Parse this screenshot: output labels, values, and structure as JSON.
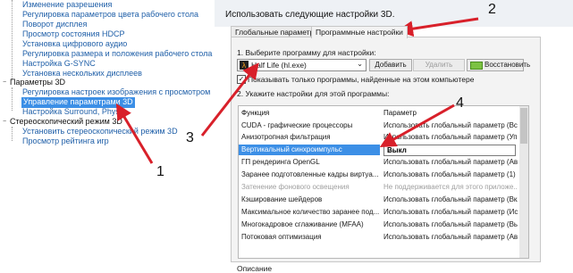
{
  "tree": {
    "items": [
      {
        "label": "Изменение разрешения"
      },
      {
        "label": "Регулировка параметров цвета рабочего стола"
      },
      {
        "label": "Поворот дисплея"
      },
      {
        "label": "Просмотр состояния HDCP"
      },
      {
        "label": "Установка цифрового аудио"
      },
      {
        "label": "Регулировка размера и положения рабочего стола"
      },
      {
        "label": "Настройка G-SYNC"
      },
      {
        "label": "Установка нескольких дисплеев"
      },
      {
        "label": "Параметры 3D"
      },
      {
        "label": "Регулировка настроек изображения с просмотром"
      },
      {
        "label": "Управление параметрами 3D"
      },
      {
        "label": "Настройка Surround, PhysX"
      },
      {
        "label": "Стереоскопический режим 3D"
      },
      {
        "label": "Установить стереоскопический режим 3D"
      },
      {
        "label": "Просмотр рейтинга игр"
      }
    ]
  },
  "right": {
    "heading": "Использовать следующие настройки 3D.",
    "tabs": [
      {
        "label": "Глобальные параметры"
      },
      {
        "label": "Программные настройки"
      }
    ],
    "step1_label": "1. Выберите программу для настройки:",
    "program_selected": "Half Life (hl.exe)",
    "add_button": "Добавить",
    "remove_button": "Удалить",
    "restore_button": "Восстановить",
    "show_only_checkbox": "Показывать только программы, найденные на этом компьютере",
    "step2_label": "2. Укажите настройки для этой программы:",
    "table": {
      "headers": [
        "Функция",
        "Параметр"
      ],
      "rows": [
        {
          "feature": "CUDA - графические процессоры",
          "value": "Использовать глобальный параметр (Все)"
        },
        {
          "feature": "Анизотропная фильтрация",
          "value": "Использовать глобальный параметр (Упр..."
        },
        {
          "feature": "Вертикальный синхроимпульс",
          "value": "Выкл"
        },
        {
          "feature": "ГП рендеринга OpenGL",
          "value": "Использовать глобальный параметр (Авт..."
        },
        {
          "feature": "Заранее подготовленные кадры виртуа...",
          "value": "Использовать глобальный параметр (1)"
        },
        {
          "feature": "Затенение фонового освещения",
          "value": "Не поддерживается для этого приложе..."
        },
        {
          "feature": "Кэширование шейдеров",
          "value": "Использовать глобальный параметр (Вкл)"
        },
        {
          "feature": "Максимальное количество заранее под...",
          "value": "Использовать глобальный параметр (Ис..."
        },
        {
          "feature": "Многокадровое сглаживание (MFAA)",
          "value": "Использовать глобальный параметр (Вы..."
        },
        {
          "feature": "Потоковая оптимизация",
          "value": "Использовать глобальный параметр (Ав..."
        }
      ]
    },
    "description_label": "Описание"
  },
  "annotations": [
    "1",
    "2",
    "3",
    "4"
  ],
  "colors": {
    "selection": "#3c8fe6",
    "arrow": "#d8202a",
    "link": "#1f5fa8"
  }
}
